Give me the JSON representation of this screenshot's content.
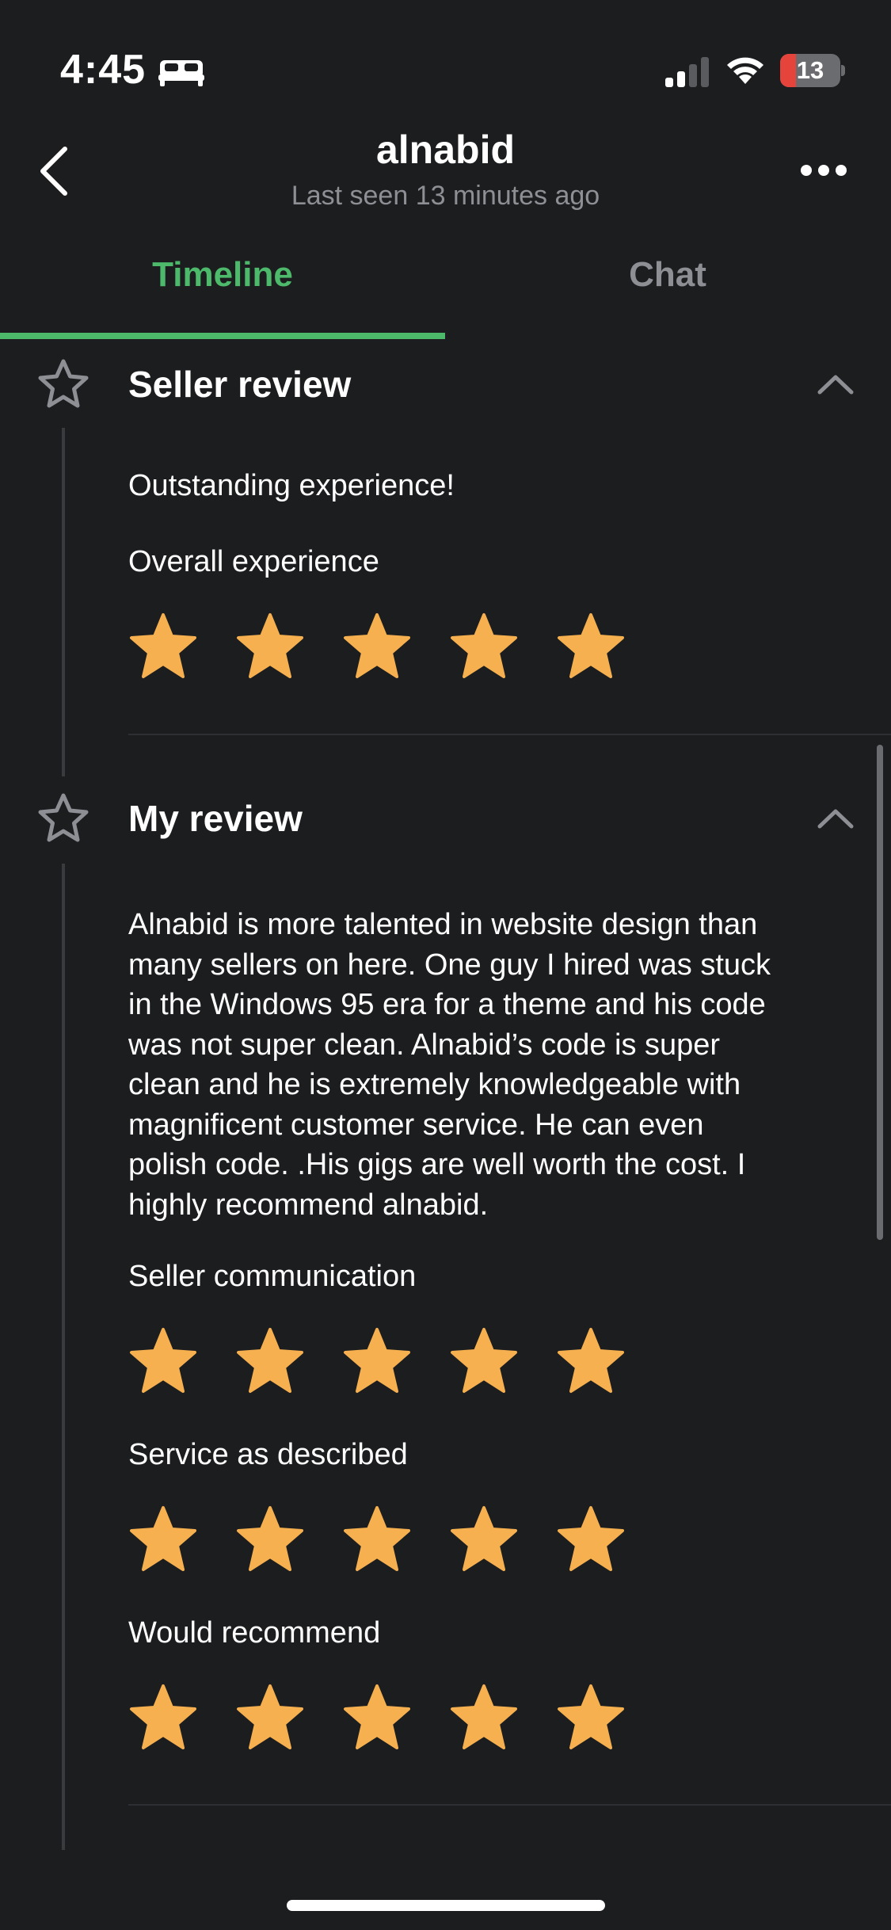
{
  "status_bar": {
    "time": "4:45",
    "battery_level": "13",
    "battery_fraction": 0.13,
    "icons": [
      "bed-icon",
      "cellular-signal-icon",
      "wifi-icon",
      "battery-charging-icon"
    ]
  },
  "header": {
    "title": "alnabid",
    "subtitle": "Last seen 13 minutes ago",
    "back_icon": "chevron-left-icon",
    "more_icon": "ellipsis-icon"
  },
  "tabs": [
    {
      "label": "Timeline",
      "active": true
    },
    {
      "label": "Chat",
      "active": false
    }
  ],
  "colors": {
    "accent": "#4cb96b",
    "star": "#f6b04f",
    "background": "#1c1d1f",
    "muted_text": "#8d8f94"
  },
  "seller_review": {
    "title": "Seller review",
    "headline": "Outstanding experience!",
    "ratings": [
      {
        "label": "Overall experience",
        "stars": 5,
        "max": 5
      }
    ]
  },
  "my_review": {
    "title": "My review",
    "body_lines": [
      "Alnabid is more talented in website design than",
      "many sellers on here. One guy I hired was stuck",
      "in the Windows 95 era for a theme and his code",
      "was not super clean. Alnabid’s code is super",
      "clean and he is extremely knowledgeable with",
      "magnificent customer service. He can even",
      "polish code. .His gigs are well worth the cost. I",
      "highly recommend alnabid."
    ],
    "ratings": [
      {
        "label": "Seller communication",
        "stars": 5,
        "max": 5
      },
      {
        "label": "Service as described",
        "stars": 5,
        "max": 5
      },
      {
        "label": "Would recommend",
        "stars": 5,
        "max": 5
      }
    ]
  }
}
